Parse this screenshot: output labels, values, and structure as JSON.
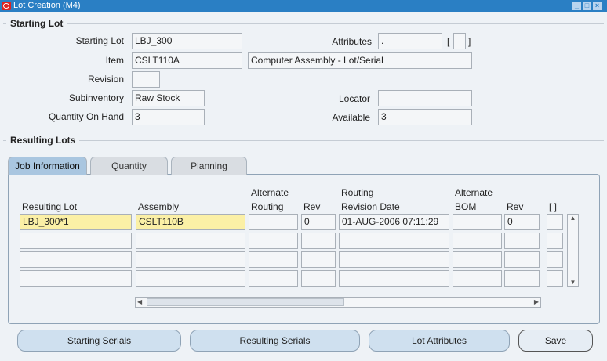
{
  "window": {
    "title": "Lot Creation (M4)",
    "controls": [
      "minimize",
      "maximize",
      "close"
    ]
  },
  "starting_lot": {
    "heading": "Starting Lot",
    "starting_lot_label": "Starting Lot",
    "starting_lot_value": "LBJ_300",
    "attributes_label": "Attributes",
    "attributes_value": ".",
    "attributes_bracket_open": "[",
    "attributes_bracket_close": "]",
    "item_label": "Item",
    "item_value": "CSLT110A",
    "item_description": "Computer Assembly - Lot/Serial",
    "revision_label": "Revision",
    "revision_value": "",
    "subinventory_label": "Subinventory",
    "subinventory_value": "Raw Stock",
    "locator_label": "Locator",
    "locator_value": "",
    "qoh_label": "Quantity On Hand",
    "qoh_value": "3",
    "available_label": "Available",
    "available_value": "3"
  },
  "resulting_lots": {
    "heading": "Resulting Lots",
    "tabs": [
      {
        "label": "Job Information",
        "active": true
      },
      {
        "label": "Quantity"
      },
      {
        "label": "Planning"
      }
    ],
    "columns": [
      {
        "line1": "",
        "line2": "Resulting Lot"
      },
      {
        "line1": "",
        "line2": "Assembly"
      },
      {
        "line1": "Alternate",
        "line2": "Routing"
      },
      {
        "line1": "",
        "line2": "Rev"
      },
      {
        "line1": "Routing",
        "line2": "Revision Date"
      },
      {
        "line1": "Alternate",
        "line2": "BOM"
      },
      {
        "line1": "",
        "line2": "Rev"
      },
      {
        "line1": "",
        "line2": "[ ]"
      }
    ],
    "rows": [
      [
        "LBJ_300*1",
        "CSLT110B",
        "",
        "0",
        "01-AUG-2006 07:11:29",
        "",
        "0",
        ""
      ],
      [
        "",
        "",
        "",
        "",
        "",
        "",
        "",
        ""
      ],
      [
        "",
        "",
        "",
        "",
        "",
        "",
        "",
        ""
      ],
      [
        "",
        "",
        "",
        "",
        "",
        "",
        "",
        ""
      ]
    ]
  },
  "buttons": {
    "starting_serials": "Starting Serials",
    "resulting_serials": "Resulting Serials",
    "lot_attributes": "Lot Attributes",
    "save": "Save"
  },
  "colors": {
    "titlebar": "#2a7fc4",
    "required_field": "#fbf0a6",
    "background": "#eef2f6"
  }
}
